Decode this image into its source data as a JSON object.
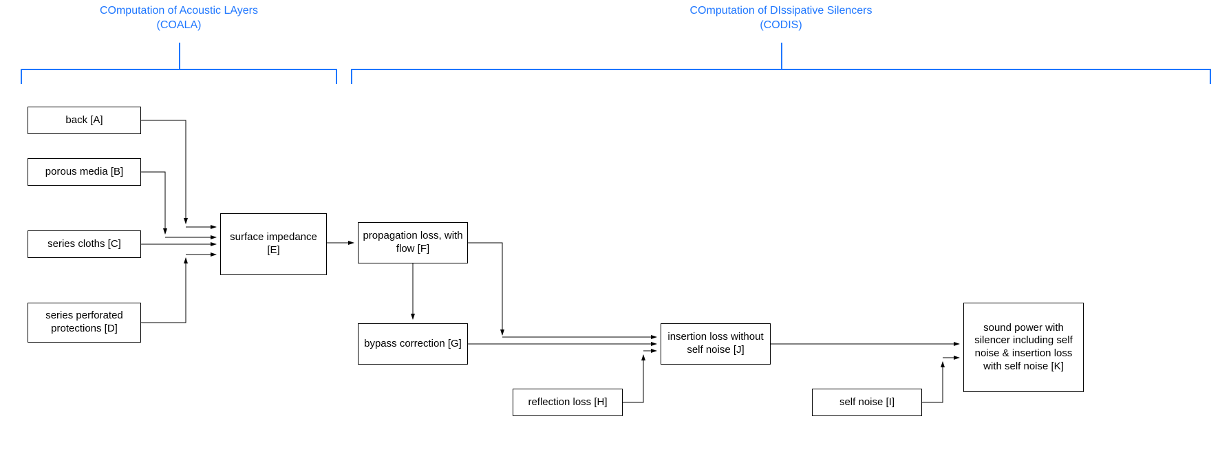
{
  "groups": {
    "coala": {
      "line1": "COmputation of Acoustic LAyers",
      "line2": "(COALA)"
    },
    "codis": {
      "line1": "COmputation of DIssipative Silencers",
      "line2": "(CODIS)"
    }
  },
  "nodes": {
    "A": "back [A]",
    "B": "porous media [B]",
    "C": "series cloths [C]",
    "D": "series perforated protections [D]",
    "E": "surface impedance [E]",
    "F": "propagation loss, with flow [F]",
    "G": "bypass correction [G]",
    "H": "reflection loss [H]",
    "I": "self noise [I]",
    "J": "insertion loss without self noise [J]",
    "K": "sound power with silencer including self noise & insertion loss with self noise [K]"
  }
}
